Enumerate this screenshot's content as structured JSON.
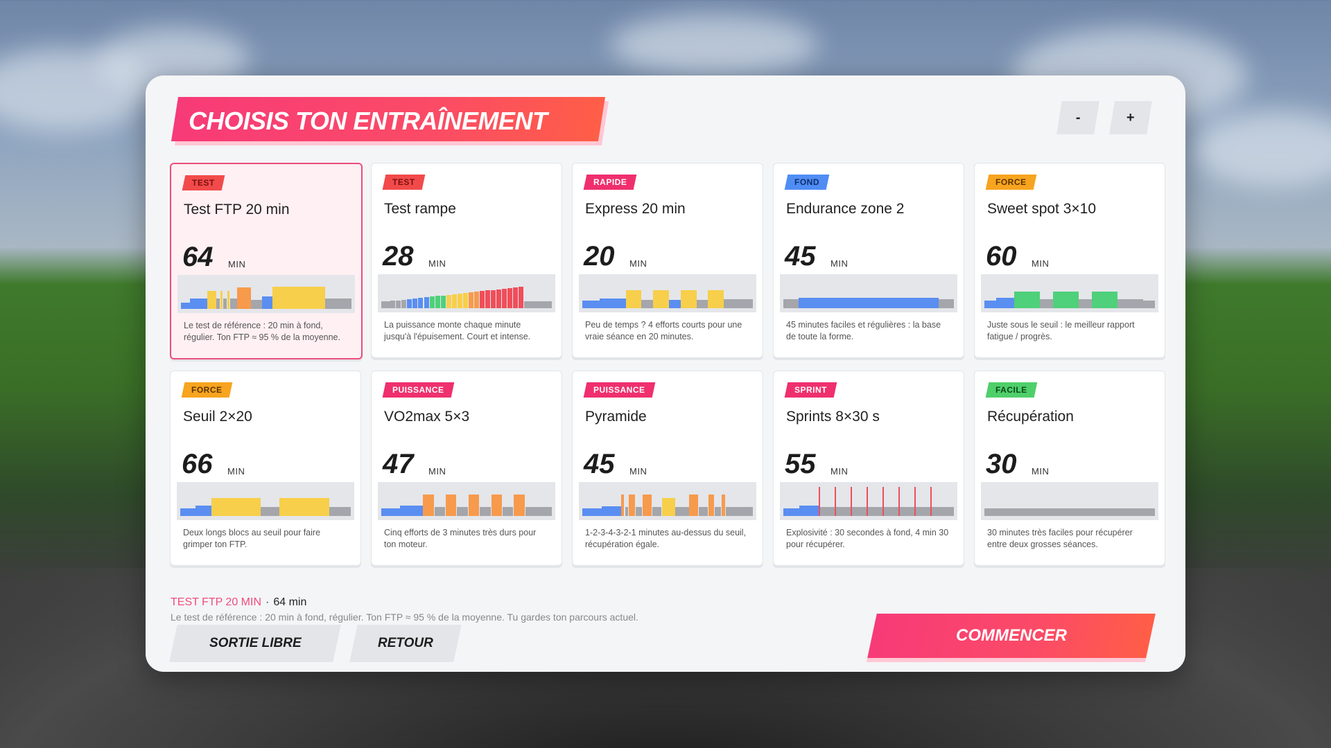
{
  "colors": {
    "accent": "#f73a78",
    "accent_end": "#ff5e47",
    "tag_test": "#f24a4a",
    "tag_rapide": "#ef2f6e",
    "tag_fond": "#4f8df5",
    "tag_force": "#f7a41f",
    "tag_puissance": "#ef2f6e",
    "tag_sprint": "#ef2f6e",
    "tag_facile": "#4fcf6a",
    "zone_grey": "#a4a6ab",
    "zone_blue": "#5a8ef1",
    "zone_green": "#4fd07a",
    "zone_yellow": "#f7cf4a",
    "zone_orange": "#f79a4c",
    "zone_red": "#ef4e5a"
  },
  "header": {
    "title": "CHOISIS TON ENTRAÎNEMENT",
    "zoom_out": "-",
    "zoom_in": "+"
  },
  "unit_label": "MIN",
  "workouts": [
    {
      "tag": "TEST",
      "tag_color": "#f24a4a",
      "tag_text": "#7a1010",
      "title": "Test FTP 20 min",
      "duration": "64",
      "selected": true,
      "desc": "Le test de référence : 20 min à fond, régulier. Ton FTP ≈ 95 % de la moyenne.",
      "profile": [
        [
          "b",
          0.2,
          1
        ],
        [
          "b",
          0.35,
          2
        ],
        [
          "y",
          0.6,
          1
        ],
        [
          "g",
          0.35,
          0.5
        ],
        [
          "y",
          0.6,
          0.3
        ],
        [
          "g",
          0.35,
          0.5
        ],
        [
          "y",
          0.6,
          0.3
        ],
        [
          "g",
          0.35,
          0.8
        ],
        [
          "o",
          0.7,
          1.6
        ],
        [
          "g",
          0.3,
          1.2
        ],
        [
          "b",
          0.4,
          1.2
        ],
        [
          "y",
          0.72,
          6
        ],
        [
          "g",
          0.35,
          3
        ]
      ]
    },
    {
      "tag": "TEST",
      "tag_color": "#f24a4a",
      "tag_text": "#7a1010",
      "title": "Test rampe",
      "duration": "28",
      "selected": false,
      "desc": "La puissance monte chaque minute jusqu'à l'épuisement. Court et intense.",
      "profile": [
        [
          "g",
          0.22,
          1
        ],
        [
          "g",
          0.24,
          0.6
        ],
        [
          "g",
          0.26,
          0.6
        ],
        [
          "g",
          0.28,
          0.6
        ],
        [
          "b",
          0.3,
          0.6
        ],
        [
          "b",
          0.32,
          0.6
        ],
        [
          "b",
          0.34,
          0.6
        ],
        [
          "b",
          0.36,
          0.6
        ],
        [
          "gr",
          0.38,
          0.6
        ],
        [
          "gr",
          0.4,
          0.6
        ],
        [
          "gr",
          0.42,
          0.6
        ],
        [
          "y",
          0.44,
          0.6
        ],
        [
          "y",
          0.46,
          0.6
        ],
        [
          "y",
          0.48,
          0.6
        ],
        [
          "y",
          0.5,
          0.6
        ],
        [
          "o",
          0.52,
          0.6
        ],
        [
          "o",
          0.54,
          0.6
        ],
        [
          "r",
          0.56,
          0.6
        ],
        [
          "r",
          0.58,
          0.6
        ],
        [
          "r",
          0.6,
          0.6
        ],
        [
          "r",
          0.62,
          0.6
        ],
        [
          "r",
          0.64,
          0.6
        ],
        [
          "r",
          0.66,
          0.6
        ],
        [
          "r",
          0.68,
          0.6
        ],
        [
          "r",
          0.7,
          0.6
        ],
        [
          "g",
          0.22,
          3
        ]
      ]
    },
    {
      "tag": "RAPIDE",
      "tag_color": "#ef2f6e",
      "tag_text": "#ffffff",
      "title": "Express 20 min",
      "duration": "20",
      "selected": false,
      "desc": "Peu de temps ? 4 efforts courts pour une vraie séance en 20 minutes.",
      "profile": [
        [
          "b",
          0.25,
          1.2
        ],
        [
          "b",
          0.32,
          1.8
        ],
        [
          "y",
          0.6,
          1.1
        ],
        [
          "g",
          0.28,
          0.8
        ],
        [
          "y",
          0.6,
          1.1
        ],
        [
          "b",
          0.28,
          0.8
        ],
        [
          "y",
          0.6,
          1.1
        ],
        [
          "g",
          0.28,
          0.8
        ],
        [
          "y",
          0.6,
          1.1
        ],
        [
          "g",
          0.3,
          2
        ]
      ]
    },
    {
      "tag": "FOND",
      "tag_color": "#4f8df5",
      "tag_text": "#0e2d6a",
      "title": "Endurance zone 2",
      "duration": "45",
      "selected": false,
      "desc": "45 minutes faciles et régulières : la base de toute la forme.",
      "profile": [
        [
          "g",
          0.3,
          1
        ],
        [
          "b",
          0.35,
          9
        ],
        [
          "g",
          0.3,
          1
        ]
      ]
    },
    {
      "tag": "FORCE",
      "tag_color": "#f7a41f",
      "tag_text": "#5a3300",
      "title": "Sweet spot 3×10",
      "duration": "60",
      "selected": false,
      "desc": "Juste sous le seuil : le meilleur rapport fatigue / progrès.",
      "profile": [
        [
          "b",
          0.25,
          0.8
        ],
        [
          "b",
          0.35,
          1.2
        ],
        [
          "gr",
          0.55,
          1.7
        ],
        [
          "g",
          0.3,
          0.9
        ],
        [
          "gr",
          0.55,
          1.7
        ],
        [
          "g",
          0.3,
          0.9
        ],
        [
          "gr",
          0.55,
          1.7
        ],
        [
          "g",
          0.3,
          0.9
        ],
        [
          "g",
          0.3,
          0.8
        ],
        [
          "g",
          0.25,
          0.8
        ]
      ]
    },
    {
      "tag": "FORCE",
      "tag_color": "#f7a41f",
      "tag_text": "#5a3300",
      "title": "Seuil 2×20",
      "duration": "66",
      "selected": false,
      "desc": "Deux longs blocs au seuil pour faire grimper ton FTP.",
      "profile": [
        [
          "b",
          0.25,
          1
        ],
        [
          "b",
          0.35,
          1
        ],
        [
          "y",
          0.6,
          3.2
        ],
        [
          "g",
          0.3,
          1.2
        ],
        [
          "y",
          0.6,
          3.2
        ],
        [
          "g",
          0.3,
          1.4
        ]
      ]
    },
    {
      "tag": "PUISSANCE",
      "tag_color": "#ef2f6e",
      "tag_text": "#ffffff",
      "title": "VO2max 5×3",
      "duration": "47",
      "selected": false,
      "desc": "Cinq efforts de 3 minutes très durs pour ton moteur.",
      "profile": [
        [
          "b",
          0.25,
          1
        ],
        [
          "b",
          0.35,
          1.2
        ],
        [
          "o",
          0.7,
          0.6
        ],
        [
          "g",
          0.3,
          0.6
        ],
        [
          "o",
          0.7,
          0.6
        ],
        [
          "g",
          0.3,
          0.6
        ],
        [
          "o",
          0.7,
          0.6
        ],
        [
          "g",
          0.3,
          0.6
        ],
        [
          "o",
          0.7,
          0.6
        ],
        [
          "g",
          0.3,
          0.6
        ],
        [
          "o",
          0.7,
          0.6
        ],
        [
          "g",
          0.3,
          1.4
        ]
      ]
    },
    {
      "tag": "PUISSANCE",
      "tag_color": "#ef2f6e",
      "tag_text": "#ffffff",
      "title": "Pyramide",
      "duration": "45",
      "selected": false,
      "desc": "1-2-3-4-3-2-1 minutes au-dessus du seuil, récupération égale.",
      "profile": [
        [
          "b",
          0.25,
          1
        ],
        [
          "b",
          0.32,
          1
        ],
        [
          "o",
          0.7,
          0.2
        ],
        [
          "g",
          0.3,
          0.2
        ],
        [
          "o",
          0.7,
          0.35
        ],
        [
          "g",
          0.3,
          0.35
        ],
        [
          "o",
          0.7,
          0.5
        ],
        [
          "g",
          0.3,
          0.5
        ],
        [
          "y",
          0.6,
          0.7
        ],
        [
          "g",
          0.3,
          0.7
        ],
        [
          "o",
          0.7,
          0.5
        ],
        [
          "g",
          0.3,
          0.5
        ],
        [
          "o",
          0.7,
          0.35
        ],
        [
          "g",
          0.3,
          0.35
        ],
        [
          "o",
          0.7,
          0.2
        ],
        [
          "g",
          0.3,
          1.4
        ]
      ]
    },
    {
      "tag": "SPRINT",
      "tag_color": "#ef2f6e",
      "tag_text": "#ffffff",
      "title": "Sprints 8×30 s",
      "duration": "55",
      "selected": false,
      "desc": "Explosivité : 30 secondes à fond, 4 min 30 pour récupérer.",
      "profile": [
        [
          "b",
          0.25,
          1
        ],
        [
          "b",
          0.35,
          1.2
        ],
        [
          "r",
          0.95,
          0.1
        ],
        [
          "g",
          0.3,
          0.9
        ],
        [
          "r",
          0.95,
          0.1
        ],
        [
          "g",
          0.3,
          0.9
        ],
        [
          "r",
          0.95,
          0.1
        ],
        [
          "g",
          0.3,
          0.9
        ],
        [
          "r",
          0.95,
          0.1
        ],
        [
          "g",
          0.3,
          0.9
        ],
        [
          "r",
          0.95,
          0.1
        ],
        [
          "g",
          0.3,
          0.9
        ],
        [
          "r",
          0.95,
          0.1
        ],
        [
          "g",
          0.3,
          0.9
        ],
        [
          "r",
          0.95,
          0.1
        ],
        [
          "g",
          0.3,
          0.9
        ],
        [
          "r",
          0.95,
          0.1
        ],
        [
          "g",
          0.3,
          1.4
        ]
      ]
    },
    {
      "tag": "FACILE",
      "tag_color": "#4fcf6a",
      "tag_text": "#0c4a1a",
      "title": "Récupération",
      "duration": "30",
      "selected": false,
      "desc": "30 minutes très faciles pour récupérer entre deux grosses séances.",
      "profile": [
        [
          "g",
          0.25,
          1
        ]
      ]
    }
  ],
  "selection": {
    "name": "TEST FTP 20 MIN",
    "separator": "·",
    "duration": "64 min",
    "description": "Le test de référence : 20 min à fond, régulier. Ton FTP ≈ 95 % de la moyenne. Tu gardes ton parcours actuel."
  },
  "buttons": {
    "free_ride": "SORTIE LIBRE",
    "back": "RETOUR",
    "start": "COMMENCER"
  }
}
